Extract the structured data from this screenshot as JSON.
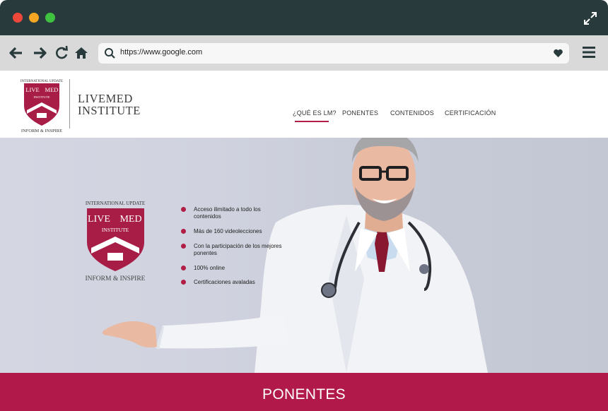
{
  "browser": {
    "url": "https://www.google.com",
    "icons": [
      "back-arrow-icon",
      "forward-arrow-icon",
      "reload-icon",
      "home-icon",
      "search-icon",
      "heart-icon",
      "hamburger-menu-icon",
      "expand-icon"
    ]
  },
  "site": {
    "logo": {
      "line1": "LIVEMED",
      "line2": "INSTITUTE",
      "emblem_top": "INTERNATIONAL UPDATE",
      "emblem_left": "LIVE",
      "emblem_right": "MED",
      "emblem_sub": "INSTITUTE",
      "emblem_motto": "INFORM & INSPIRE"
    },
    "nav": [
      {
        "label": "¿QUÉ ES LM?"
      },
      {
        "label": "PONENTES"
      },
      {
        "label": "CONTENIDOS"
      },
      {
        "label": "CERTIFICACIÓN"
      }
    ]
  },
  "hero": {
    "bullets": [
      "Acceso ilimitado a todo los contenidos",
      "Más de 160 videolecciones",
      "Con la participación de los mejores ponentes",
      "100% online",
      "Certificaciones avaladas"
    ]
  },
  "section": {
    "title": "PONENTES"
  },
  "colors": {
    "brand": "#b0194a",
    "titlebar": "#283a3c",
    "toolbar": "#d9d9d9"
  }
}
